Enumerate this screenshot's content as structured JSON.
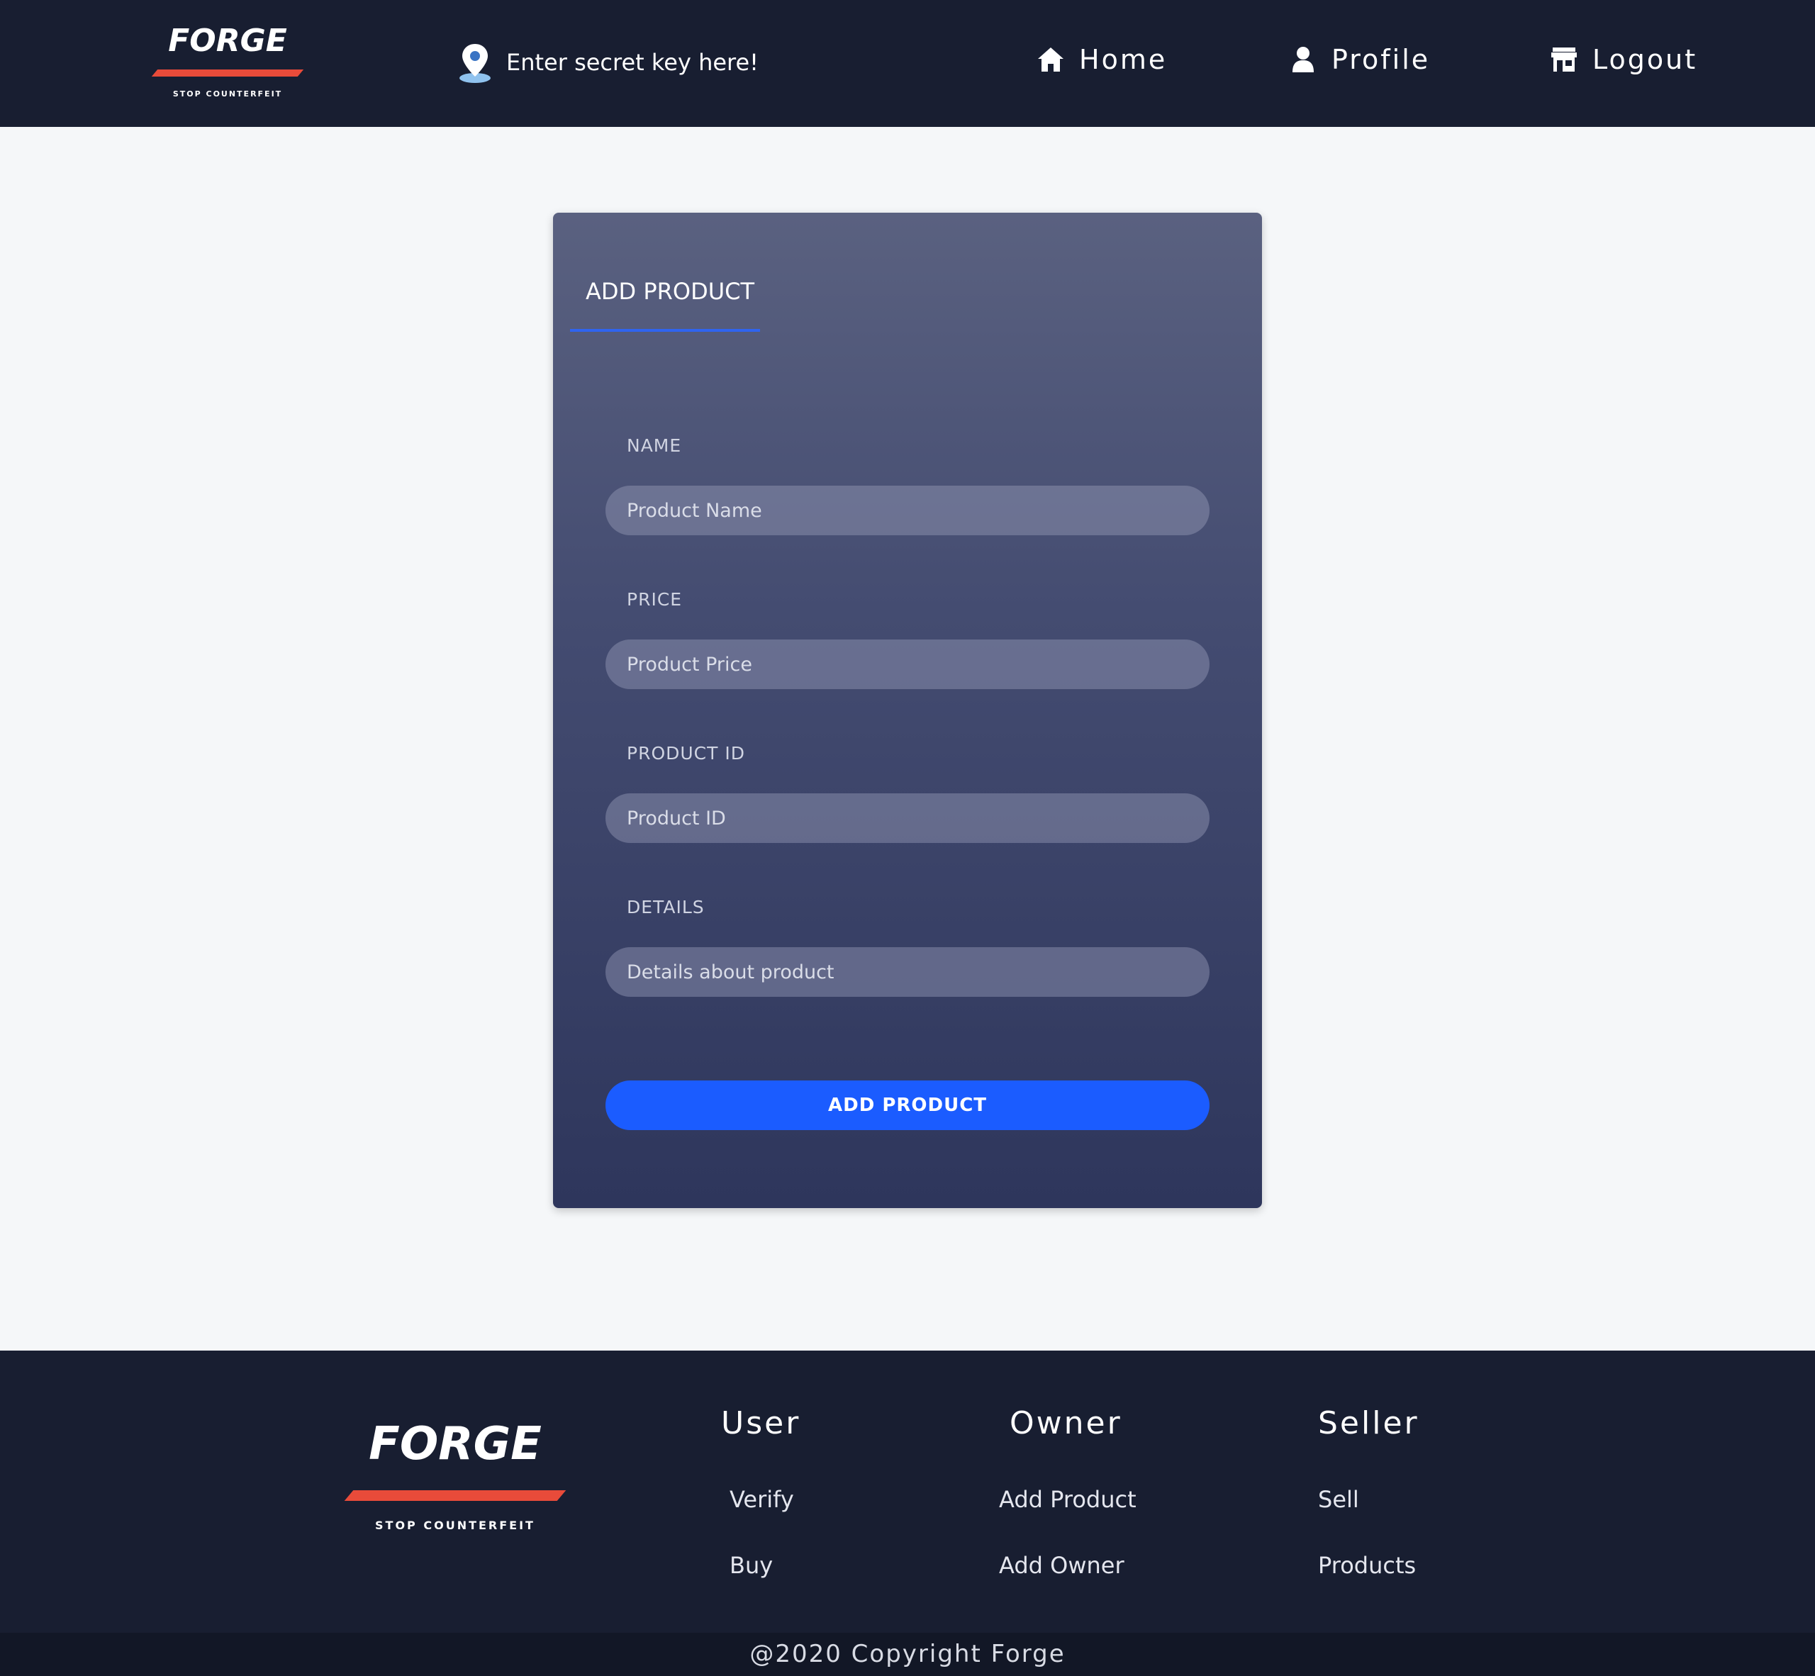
{
  "brand": {
    "name": "FORGE",
    "tagline": "STOP COUNTERFEIT",
    "accent": "#e84b3a"
  },
  "header": {
    "secret_placeholder": "Enter secret key here!",
    "nav": {
      "home": "Home",
      "profile": "Profile",
      "logout": "Logout"
    }
  },
  "form": {
    "tab": "ADD PRODUCT",
    "name_label": "NAME",
    "name_placeholder": "Product Name",
    "price_label": "PRICE",
    "price_placeholder": "Product Price",
    "id_label": "PRODUCT ID",
    "id_placeholder": "Product ID",
    "details_label": "DETAILS",
    "details_placeholder": "Details about product",
    "submit": "ADD PRODUCT"
  },
  "footer": {
    "columns": [
      {
        "heading": "User",
        "links": [
          "Verify",
          "Buy"
        ]
      },
      {
        "heading": "Owner",
        "links": [
          "Add Product",
          "Add Owner"
        ]
      },
      {
        "heading": "Seller",
        "links": [
          "Sell",
          "Products"
        ]
      }
    ],
    "copyright": "@2020 Copyright Forge"
  },
  "icons": [
    "map-pin-icon",
    "home-icon",
    "user-icon",
    "store-icon"
  ]
}
